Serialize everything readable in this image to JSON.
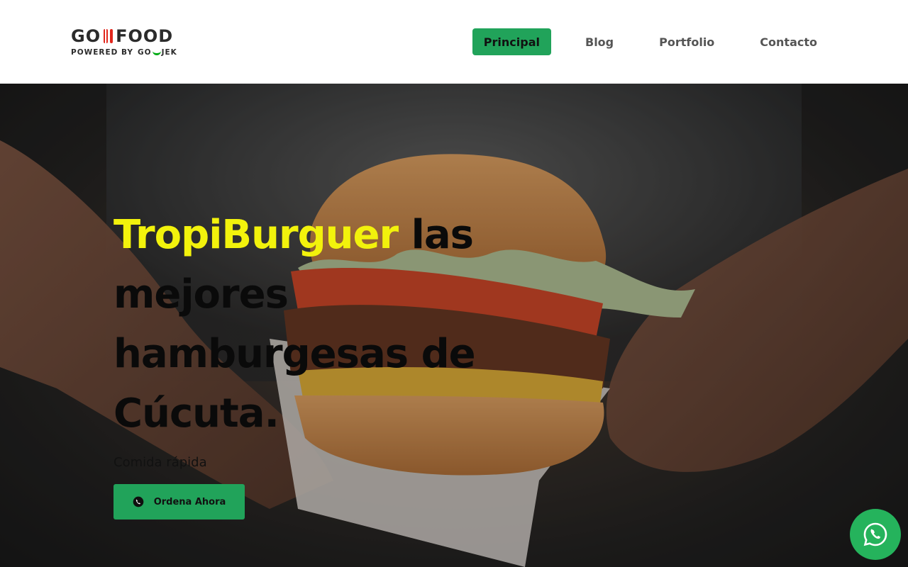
{
  "header": {
    "logo": {
      "main_left": "GO",
      "main_right": "FOOD",
      "sub_left": "POWERED BY",
      "sub_brand_left": "GO",
      "sub_brand_right": "JEK"
    },
    "nav": [
      {
        "label": "Principal",
        "active": true
      },
      {
        "label": "Blog",
        "active": false
      },
      {
        "label": "Portfolio",
        "active": false
      },
      {
        "label": "Contacto",
        "active": false
      }
    ]
  },
  "hero": {
    "headline_brand": "TropiBurguer",
    "headline_rest": " las mejores hamburgesas de Cúcuta.",
    "subtitle": "Comida rápida",
    "cta_label": "Ordena Ahora"
  },
  "icons": {
    "cta_icon": "whatsapp-icon",
    "floating_icon": "whatsapp-icon"
  },
  "colors": {
    "accent_green": "#21a35a",
    "brand_yellow": "#f2f20c",
    "logo_red": "#e1261c"
  }
}
